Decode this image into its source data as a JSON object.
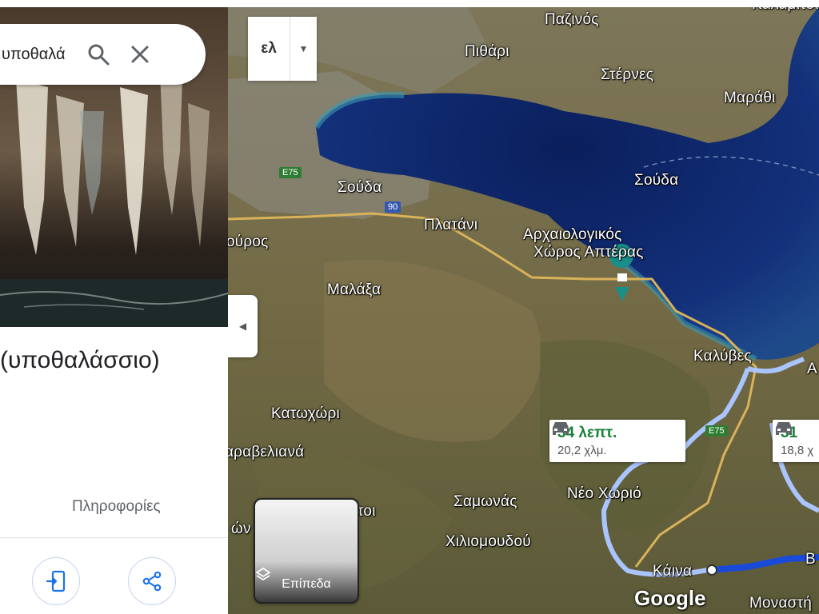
{
  "search": {
    "query": "υποθαλά"
  },
  "panel": {
    "title": "(υποθαλάσσιο)",
    "info_link": "Πληροφορίες"
  },
  "map": {
    "language_button": "ελ",
    "layers_label": "Επίπεδα",
    "google_logo": "Google",
    "labels": [
      {
        "key": "pazinos",
        "text": "Παζινός"
      },
      {
        "key": "pithari",
        "text": "Πιθάρι"
      },
      {
        "key": "sternes",
        "text": "Στέρνες"
      },
      {
        "key": "marathi",
        "text": "Μαράθι"
      },
      {
        "key": "souda_water",
        "text": "Σούδα"
      },
      {
        "key": "souda_town",
        "text": "Σούδα"
      },
      {
        "key": "platani",
        "text": "Πλατάνι"
      },
      {
        "key": "archaeo1",
        "text": "Αρχαιολογικός"
      },
      {
        "key": "archaeo2",
        "text": "Χώρος Απτέρας"
      },
      {
        "key": "ouros",
        "text": "ούρος"
      },
      {
        "key": "malaxa",
        "text": "Μαλάξα"
      },
      {
        "key": "kalyves",
        "text": "Καλύβες"
      },
      {
        "key": "katochori",
        "text": "Κατωχώρι"
      },
      {
        "key": "karavelliana",
        "text": "αραβελιανά"
      },
      {
        "key": "neo_chorio",
        "text": "Νέο Χωριό"
      },
      {
        "key": "samonas",
        "text": "Σαμωνάς"
      },
      {
        "key": "toi",
        "text": "τοι"
      },
      {
        "key": "on",
        "text": "ών"
      },
      {
        "key": "chiliomoudou",
        "text": "Χιλιομουδού"
      },
      {
        "key": "kaina",
        "text": "Κάινα"
      },
      {
        "key": "monastiri",
        "text": "Μοναστή"
      },
      {
        "key": "b_edge",
        "text": "Β"
      },
      {
        "key": "a_edge",
        "text": "Α"
      },
      {
        "key": "top_edge",
        "text": "Καλαμίτσι"
      }
    ],
    "roads": {
      "e75_a": "E75",
      "e75_b": "E75",
      "r90": "90"
    },
    "routes": [
      {
        "time": "34 λεπτ.",
        "distance": "20,2 χλμ."
      },
      {
        "time": "31",
        "distance": "18,8 χ"
      }
    ],
    "colors": {
      "sea": "#0f2a6e",
      "route": "#aac4ff",
      "route_active": "#1a4bd8",
      "route_time": "#188038"
    }
  }
}
